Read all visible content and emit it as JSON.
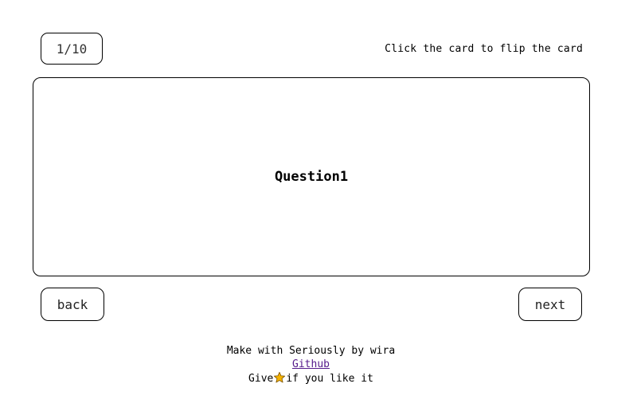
{
  "counter": {
    "text": "1/10"
  },
  "hint": {
    "text": "Click the card to flip the card"
  },
  "card": {
    "text": "Question1"
  },
  "nav": {
    "back_label": "back",
    "next_label": "next"
  },
  "footer": {
    "credit": "Make with Seriously by wira",
    "link_label": "Github",
    "give_prefix": "Give",
    "give_suffix": "if you like it",
    "star_icon": "star-icon",
    "star_color": "#f5b301",
    "link_color": "#551a8b"
  }
}
